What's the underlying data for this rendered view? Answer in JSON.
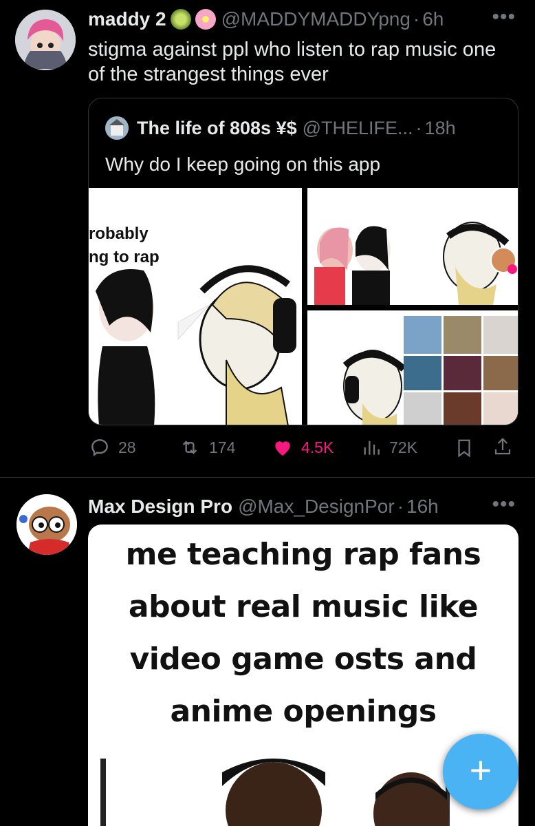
{
  "tweet1": {
    "name": "maddy 2",
    "handle": "@MADDYMADDYpng",
    "time": "6h",
    "text_line1": "stigma against ppl who listen to rap music one",
    "text_line2": "of the strangest  things ever",
    "badges": [
      "kiwi-icon",
      "flower-icon"
    ],
    "quote": {
      "name": "The life of 808s ¥$",
      "handle": "@THELIFE...",
      "time": "18h",
      "text": "Why do I keep going on this app",
      "media_caption_line1": "robably",
      "media_caption_line2": "ng to rap"
    },
    "stats": {
      "replies": "28",
      "reposts": "174",
      "likes": "4.5K",
      "views": "72K"
    },
    "like_color": "#f91880"
  },
  "tweet2": {
    "name": "Max Design Pro",
    "handle": "@Max_DesignPor",
    "time": "16h",
    "meme_line1": "me teaching rap fans",
    "meme_line2": "about real music like",
    "meme_line3": "video game osts and",
    "meme_line4": "anime openings"
  },
  "fab": {
    "icon": "plus-icon",
    "color": "#4ab3f4"
  },
  "colors": {
    "background": "#000000",
    "muted": "#71767b",
    "text": "#e7e9ea",
    "border": "#2f3336"
  }
}
